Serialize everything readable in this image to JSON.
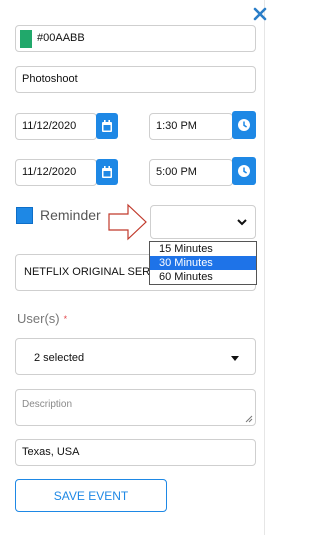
{
  "form": {
    "color_value": "#00AABB",
    "color_swatch": "#21a86b",
    "title_value": "Photoshoot",
    "start_date": "11/12/2020",
    "start_time": "1:30 PM",
    "end_date": "11/12/2020",
    "end_time": "5:00 PM",
    "reminder_label": "Reminder",
    "reminder_checked": true,
    "reminder_selected": "",
    "reminder_options": [
      "15 Minutes",
      "30 Minutes",
      "60 Minutes"
    ],
    "reminder_highlighted": "30 Minutes",
    "calendar_value": "NETFLIX ORIGINAL SERIES",
    "users_label": "User(s)",
    "users_required_mark": "*",
    "users_value": "2 selected",
    "description_placeholder": "Description",
    "location_value": "Texas, USA",
    "save_label": "SAVE EVENT"
  },
  "colors": {
    "accent": "#1e88e5",
    "required": "#e2454a",
    "option_highlight": "#1e73e8"
  },
  "icons": {
    "close": "close-icon",
    "calendar": "calendar-icon",
    "clock": "clock-icon",
    "chevron": "chevron-down-icon",
    "arrow": "arrow-right-icon"
  }
}
